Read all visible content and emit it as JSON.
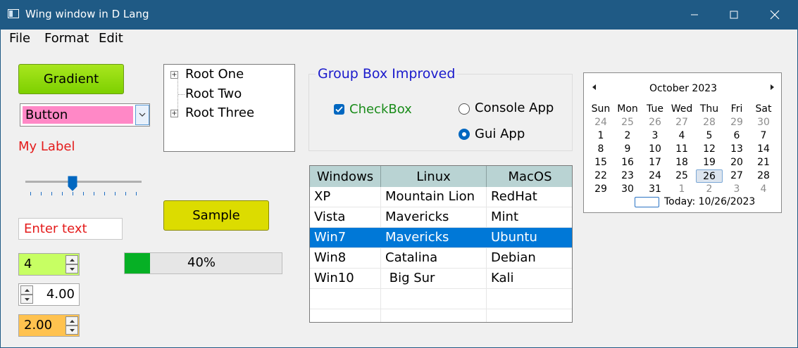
{
  "window": {
    "title": "Wing window in D Lang",
    "titlebar_color": "#1f5a85",
    "icons": [
      "app-icon",
      "minimize-icon",
      "maximize-icon",
      "close-icon"
    ]
  },
  "menu": [
    "File",
    "Format",
    "Edit"
  ],
  "gradient_button": {
    "label": "Gradient"
  },
  "combo": {
    "value": "Button"
  },
  "label": {
    "text": "My Label",
    "color": "#e41b1b"
  },
  "slider": {
    "value_fraction": 0.4
  },
  "textbox": {
    "value": "Enter text"
  },
  "spinners": [
    {
      "value": "4"
    },
    {
      "value": "4.00"
    },
    {
      "value": "2.00"
    }
  ],
  "progress": {
    "value": 40,
    "text": "40%"
  },
  "sample_button": {
    "label": "Sample"
  },
  "tree": {
    "items": [
      "Root One",
      "Root Two",
      "Root Three"
    ]
  },
  "groupbox": {
    "title": "Group Box Improved",
    "checkbox": {
      "label": "CheckBox",
      "checked": true
    },
    "radios": [
      {
        "label": "Console App",
        "selected": false
      },
      {
        "label": "Gui App",
        "selected": true
      }
    ]
  },
  "grid": {
    "columns": [
      "Windows",
      "Linux",
      "MacOS"
    ],
    "rows": [
      [
        "XP",
        "Mountain Lion",
        "RedHat"
      ],
      [
        "Vista",
        "Mavericks",
        "Mint"
      ],
      [
        "Win7",
        "Mavericks",
        "Ubuntu"
      ],
      [
        "Win8",
        "Catalina",
        "Debian"
      ],
      [
        "Win10",
        " Big Sur",
        "Kali"
      ]
    ],
    "selected_row": 2
  },
  "calendar": {
    "month": "October 2023",
    "weekdays": [
      "Sun",
      "Mon",
      "Tue",
      "Wed",
      "Thu",
      "Fri",
      "Sat"
    ],
    "weeks": [
      [
        "24",
        "25",
        "26",
        "27",
        "28",
        "29",
        "30"
      ],
      [
        "1",
        "2",
        "3",
        "4",
        "5",
        "6",
        "7"
      ],
      [
        "8",
        "9",
        "10",
        "11",
        "12",
        "13",
        "14"
      ],
      [
        "15",
        "16",
        "17",
        "18",
        "19",
        "20",
        "21"
      ],
      [
        "22",
        "23",
        "24",
        "25",
        "26",
        "27",
        "28"
      ],
      [
        "29",
        "30",
        "31",
        "1",
        "2",
        "3",
        "4"
      ]
    ],
    "selected_day": "26",
    "today_text": "Today: 10/26/2023"
  }
}
